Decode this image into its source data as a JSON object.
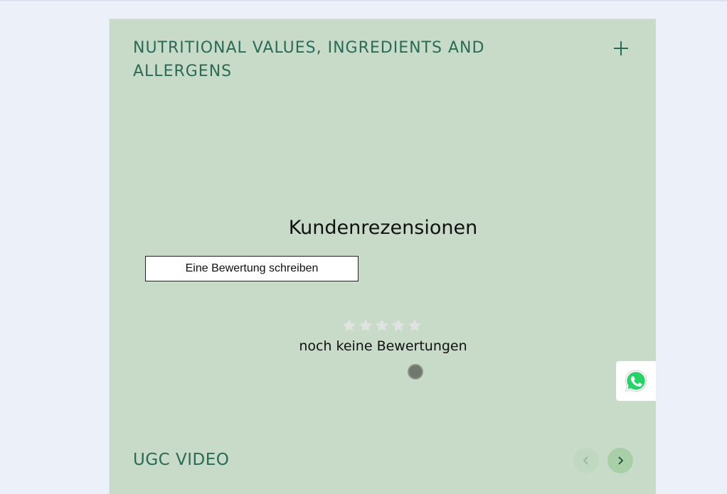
{
  "accordion": {
    "title": "NUTRITIONAL VALUES, INGREDIENTS AND ALLERGENS",
    "toggle_icon": "plus-icon"
  },
  "reviews": {
    "heading": "Kundenrezensionen",
    "write_button_label": "Eine Bewertung schreiben",
    "rating_value": 0,
    "rating_max": 5,
    "empty_text": "noch keine Bewertungen"
  },
  "ugc": {
    "title": "UGC VIDEO",
    "prev_icon": "chevron-left-icon",
    "next_icon": "chevron-right-icon"
  },
  "whatsapp": {
    "icon": "whatsapp-icon"
  },
  "colors": {
    "panel_bg": "#c8dac8",
    "accent_green": "#2a6b55",
    "page_bg": "#ecf0f9",
    "whatsapp_green": "#25d366"
  }
}
